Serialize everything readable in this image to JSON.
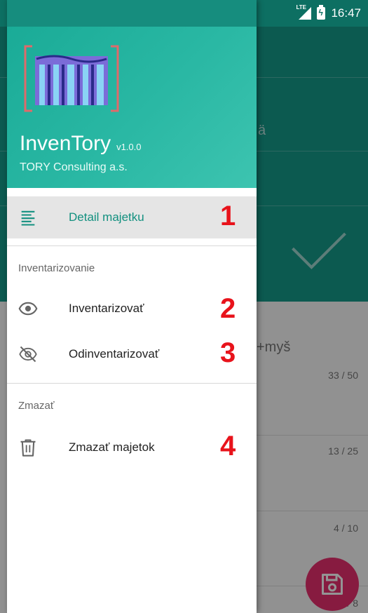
{
  "status_bar": {
    "time": "16:47",
    "network": "LTE"
  },
  "drawer": {
    "app_name": "InvenTory",
    "version": "v1.0.0",
    "company": "TORY Consulting a.s.",
    "items": [
      {
        "label": "Detail majetku",
        "icon": "list-detail-icon",
        "marker": "1"
      },
      {
        "label": "Inventarizovať",
        "icon": "eye-icon",
        "marker": "2"
      },
      {
        "label": "Odinventarizovať",
        "icon": "eye-off-icon",
        "marker": "3"
      },
      {
        "label": "Zmazať majetok",
        "icon": "trash-icon",
        "marker": "4"
      }
    ],
    "sections": [
      {
        "title": "Inventarizovanie"
      },
      {
        "title": "Zmazať"
      }
    ]
  },
  "background": {
    "partial_text": "ä",
    "search_text": "+myš",
    "counts": [
      "33 / 50",
      "13 / 25",
      "4 / 10",
      "/ 8"
    ]
  },
  "colors": {
    "primary": "#159b8a",
    "primary_dark": "#0d6f62",
    "accent": "#e8306e",
    "marker": "#e8131b",
    "selected_text": "#12907f"
  }
}
